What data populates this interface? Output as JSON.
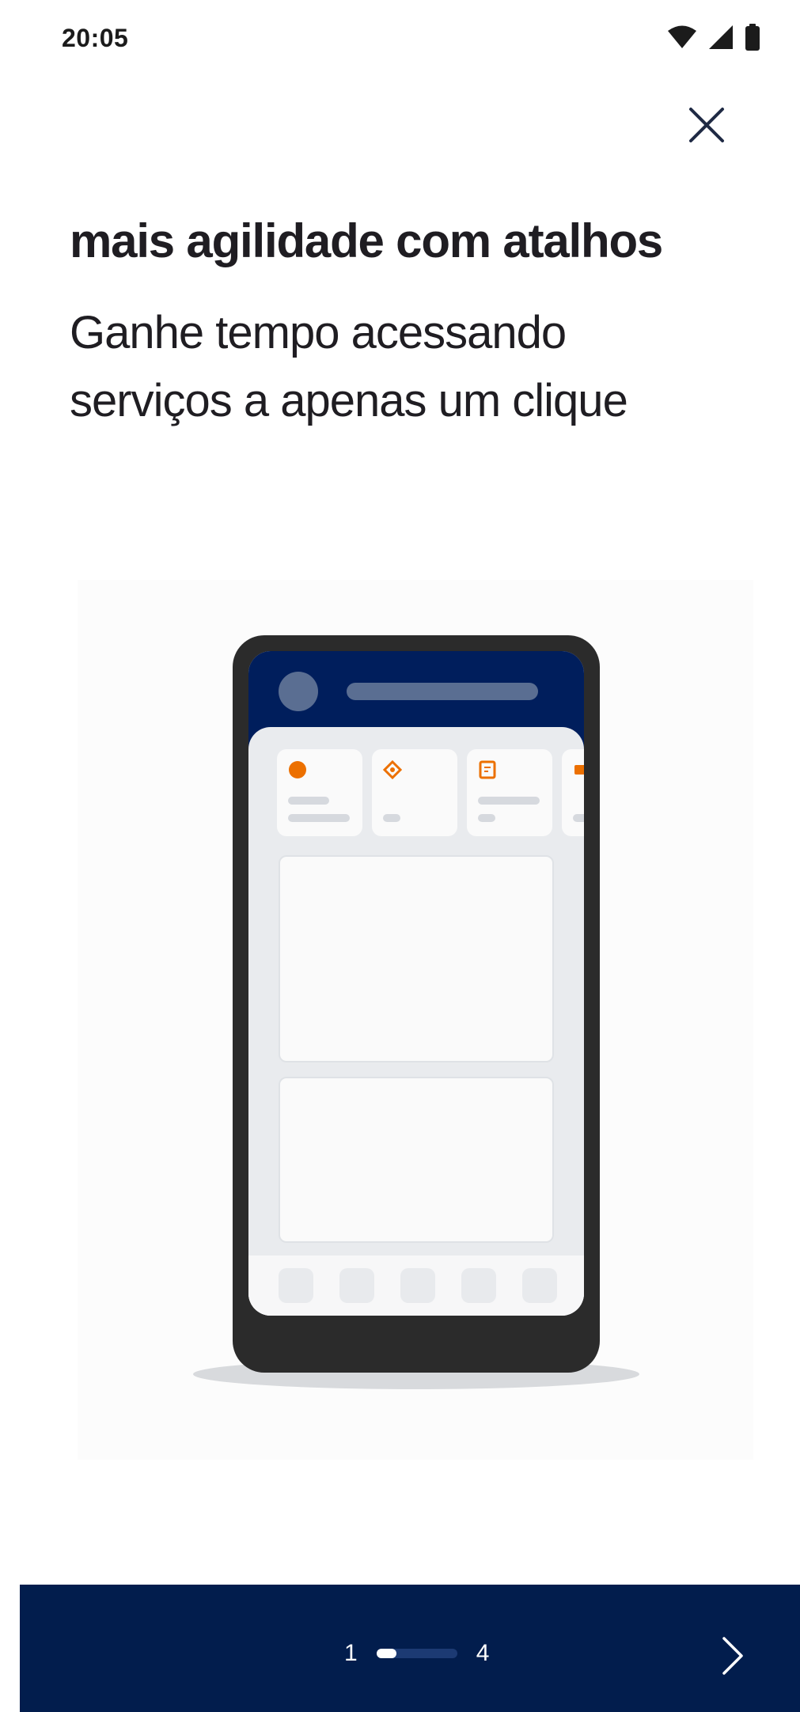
{
  "status_bar": {
    "time": "20:05",
    "icons": [
      "wifi-icon",
      "signal-icon",
      "battery-icon"
    ]
  },
  "header": {
    "close_icon": "close-icon"
  },
  "content": {
    "title": "mais agilidade com atalhos",
    "subtitle": "Ganhe tempo acessando serviços a apenas um clique"
  },
  "illustration": {
    "depicts": "phone-mockup-shortcuts",
    "colors": {
      "phone_frame": "#2b2b2b",
      "phone_header": "#001e5c",
      "accent_orange": "#ec7000"
    }
  },
  "pager": {
    "current": "1",
    "total": "4",
    "progress": 0.25,
    "next_icon": "chevron-right-icon"
  },
  "theme": {
    "bottom_bar": "#021d4d",
    "text_primary": "#1f1d22"
  }
}
